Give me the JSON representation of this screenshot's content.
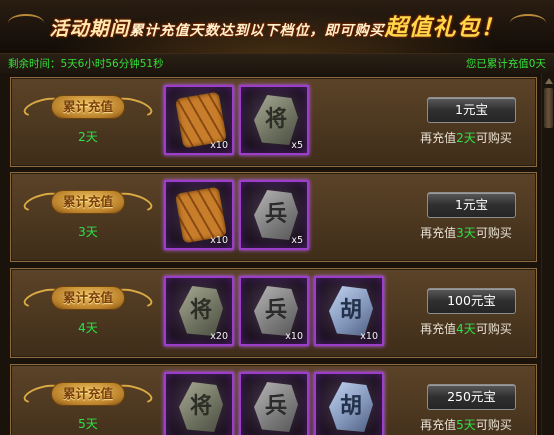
{
  "banner": {
    "part1": "活动期间",
    "part2": "累计充值天数达到以下档位，即可购买",
    "part3": "超值礼包！"
  },
  "info": {
    "remaining_label": "剩余时间：",
    "remaining_value": "5天6小时56分钟51秒",
    "accumulated_text": "您已累计充值0天"
  },
  "tiers": [
    {
      "badge": "累计充值",
      "days": "2天",
      "items": [
        {
          "name": "scroll-bundle",
          "glyph": "",
          "count": "x10"
        },
        {
          "name": "general-stone",
          "glyph": "将",
          "count": "x5"
        }
      ],
      "price": "1元宝",
      "hint_prefix": "再充值",
      "hint_num": "2天",
      "hint_suffix": "可购买"
    },
    {
      "badge": "累计充值",
      "days": "3天",
      "items": [
        {
          "name": "scroll-bundle",
          "glyph": "",
          "count": "x10"
        },
        {
          "name": "soldier-stone",
          "glyph": "兵",
          "count": "x5"
        }
      ],
      "price": "1元宝",
      "hint_prefix": "再充值",
      "hint_num": "3天",
      "hint_suffix": "可购买"
    },
    {
      "badge": "累计充值",
      "days": "4天",
      "items": [
        {
          "name": "general-stone",
          "glyph": "将",
          "count": "x20"
        },
        {
          "name": "soldier-stone",
          "glyph": "兵",
          "count": "x10"
        },
        {
          "name": "blue-stone",
          "glyph": "胡",
          "count": "x10"
        }
      ],
      "price": "100元宝",
      "hint_prefix": "再充值",
      "hint_num": "4天",
      "hint_suffix": "可购买"
    },
    {
      "badge": "累计充值",
      "days": "5天",
      "items": [
        {
          "name": "general-stone",
          "glyph": "将",
          "count": ""
        },
        {
          "name": "soldier-stone",
          "glyph": "兵",
          "count": ""
        },
        {
          "name": "blue-stone",
          "glyph": "胡",
          "count": ""
        }
      ],
      "price": "250元宝",
      "hint_prefix": "再充值",
      "hint_num": "5天",
      "hint_suffix": "可购买"
    }
  ],
  "colors": {
    "accent_green": "#2ee14a",
    "item_border": "#9b3ec8",
    "badge_gold": "#d9aa43"
  }
}
